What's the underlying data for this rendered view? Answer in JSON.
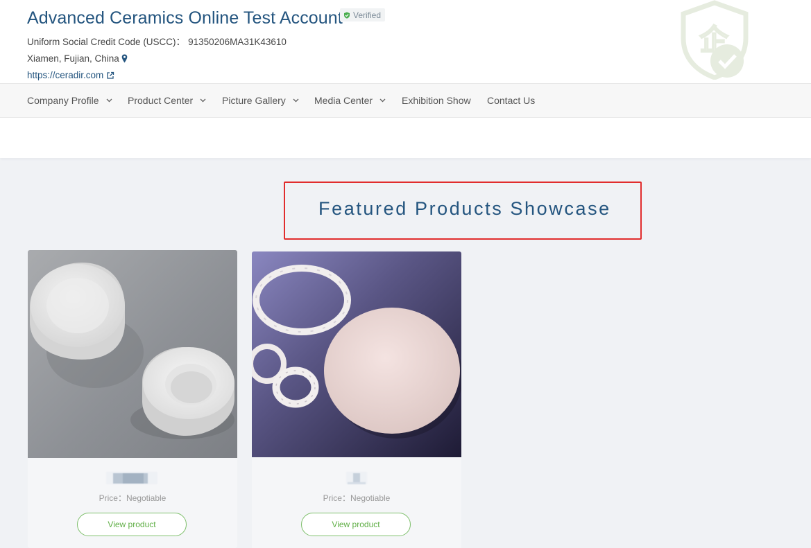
{
  "header": {
    "company_name": "Advanced Ceramics Online Test Account",
    "verified_label": "Verified",
    "uscc_label": "Uniform Social Credit Code (USCC)：",
    "uscc_value": "91350206MA31K43610",
    "location": "Xiamen, Fujian, China",
    "website": "https://ceradir.com"
  },
  "nav": {
    "items": [
      {
        "label": "Company Profile",
        "has_dropdown": true
      },
      {
        "label": "Product Center",
        "has_dropdown": true
      },
      {
        "label": "Picture Gallery",
        "has_dropdown": true
      },
      {
        "label": "Media Center",
        "has_dropdown": true
      },
      {
        "label": "Exhibition Show",
        "has_dropdown": false
      },
      {
        "label": "Contact Us",
        "has_dropdown": false
      }
    ]
  },
  "section": {
    "title": "Featured Products Showcase"
  },
  "products": [
    {
      "price": "Price：Negotiable",
      "button_label": "View product"
    },
    {
      "price": "Price：Negotiable",
      "button_label": "View product"
    }
  ],
  "colors": {
    "brand_blue": "#24557f",
    "accent_green": "#5fae45",
    "highlight_red": "#e12d2d",
    "verified_green": "#4caf50"
  },
  "icons": {
    "verified": "shield-check-icon",
    "location": "map-pin-icon",
    "website": "external-link-icon",
    "dropdown": "chevron-down-icon"
  }
}
